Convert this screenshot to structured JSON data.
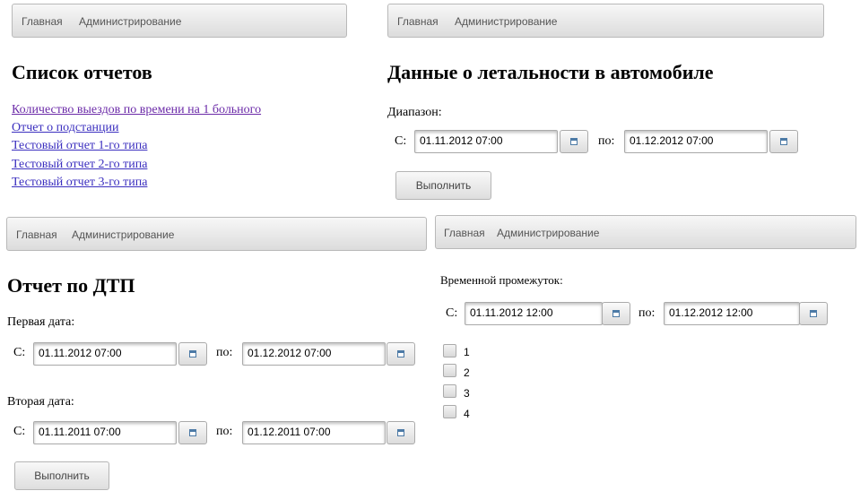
{
  "nav": {
    "home": "Главная",
    "admin": "Администрирование"
  },
  "panel1": {
    "title": "Список отчетов",
    "links": [
      "Количество выездов по времени на 1 больного",
      "Отчет о подстанции",
      "Тестовый отчет 1-го типа",
      "Тестовый отчет 2-го типа",
      "Тестовый отчет 3-го типа"
    ]
  },
  "panel2": {
    "title": "Данные о летальности в автомобиле",
    "range_label": "Диапазон:",
    "from_label": "С:",
    "to_label": "по:",
    "from_value": "01.11.2012 07:00",
    "to_value": "01.12.2012 07:00",
    "run_label": "Выполнить"
  },
  "panel3": {
    "title": "Отчет по ДТП",
    "first_date_label": "Первая дата:",
    "second_date_label": "Вторая дата:",
    "from_label": "С:",
    "to_label": "по:",
    "first_from": "01.11.2012 07:00",
    "first_to": "01.12.2012 07:00",
    "second_from": "01.11.2011 07:00",
    "second_to": "01.12.2011 07:00",
    "run_label": "Выполнить"
  },
  "panel4": {
    "period_label": "Временной промежуток:",
    "from_label": "С:",
    "to_label": "по:",
    "from_value": "01.11.2012 12:00",
    "to_value": "01.12.2012 12:00",
    "checkboxes": [
      "1",
      "2",
      "3",
      "4"
    ]
  }
}
